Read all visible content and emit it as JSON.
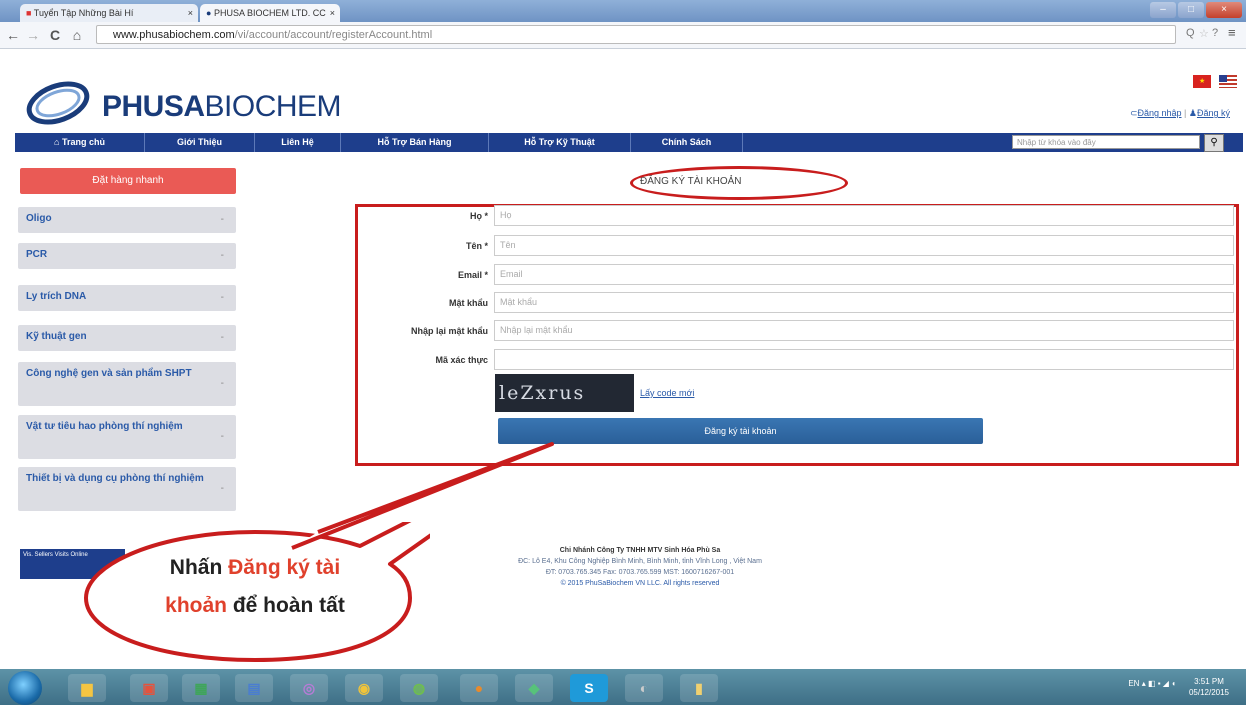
{
  "browser": {
    "tabs": [
      {
        "label": "Tuyển Tập Những Bài Hí",
        "close": "×"
      },
      {
        "label": "PHUSA BIOCHEM LTD. CC",
        "close": "×"
      }
    ],
    "window_controls": [
      "–",
      "□",
      "×"
    ],
    "nav": {
      "back": "←",
      "forward": "→",
      "reload": "C",
      "home": "⌂"
    },
    "url_host": "www.phusabiochem.com",
    "url_path": "/vi/account/account/registerAccount.html",
    "toolbar_icons": [
      "Q",
      "☆",
      "?",
      "≡"
    ]
  },
  "site": {
    "logo_bold": "PHUSA",
    "logo_light": "BIOCHEM",
    "login_link": "Đăng nhập",
    "register_link": "Đăng ký",
    "nav": [
      "Trang chủ",
      "Giới Thiệu",
      "Liên Hệ",
      "Hỗ Trợ Bán Hàng",
      "Hỗ Trợ Kỹ Thuật",
      "Chính Sách"
    ],
    "search_placeholder": "Nhập từ khóa vào đây",
    "search_icon": "search-icon"
  },
  "sidebar": {
    "quick_order": "Đặt hàng nhanh",
    "items": [
      {
        "label": "Oligo",
        "toggle": "-"
      },
      {
        "label": "PCR",
        "toggle": "-"
      },
      {
        "label": "Ly trích DNA",
        "toggle": "-"
      },
      {
        "label": "Kỹ thuật gen",
        "toggle": "-"
      },
      {
        "label": "Công nghệ gen và sản phẩm SHPT",
        "toggle": "-"
      },
      {
        "label": "Vật tư tiêu hao phòng thí nghiệm",
        "toggle": "-"
      },
      {
        "label": "Thiết bị và dụng cụ phòng thí nghiệm",
        "toggle": "-"
      }
    ]
  },
  "form": {
    "title": "ĐĂNG KÝ TÀI KHOẢN",
    "fields": [
      {
        "label": "Họ *",
        "placeholder": "Họ"
      },
      {
        "label": "Tên *",
        "placeholder": "Tên"
      },
      {
        "label": "Email *",
        "placeholder": "Email"
      },
      {
        "label": "Mật khẩu",
        "placeholder": "Mật khẩu"
      },
      {
        "label": "Nhập lại mật khẩu",
        "placeholder": "Nhập lại mật khẩu"
      },
      {
        "label": "Mã xác thực",
        "placeholder": ""
      }
    ],
    "captcha_text": "leZxrus",
    "new_code_link": "Lấy code mới",
    "submit": "Đăng ký tài khoản"
  },
  "footer": {
    "company": "Chi Nhánh Công Ty TNHH MTV Sinh Hóa Phù Sa",
    "address": "ĐC: Lô E4, Khu Công Nghiệp Bình Minh, Bình Minh, tỉnh Vĩnh Long , Việt Nam",
    "contact": "ĐT: 0703.765.345      Fax: 0703.765.599      MST: 1600716267-001",
    "copyright": "© 2015 PhuSaBiochem VN LLC. All rights reserved",
    "badge": "Vis. Sellers Visits Online"
  },
  "callout": {
    "text_1": "Nhấn ",
    "highlight_1": "Đăng ký tài",
    "highlight_2": "khoản",
    "text_2": " để hoàn tất"
  },
  "taskbar": {
    "icons": [
      "folder-icon",
      "presentation-icon",
      "excel-icon",
      "word-icon",
      "messenger-icon",
      "chrome-icon",
      "utorrent-icon",
      "firefox-icon",
      "network-icon",
      "skype-icon",
      "media-icon",
      "files-icon"
    ],
    "skype_letter": "S",
    "lang": "EN",
    "time": "3:51 PM",
    "date": "05/12/2015"
  },
  "colors": {
    "nav_blue": "#1e3e8c",
    "annotation_red": "#c81d1d",
    "quick_order_red": "#ea5a55",
    "submit_blue": "#2f6aa6",
    "callout_highlight": "#e0412c"
  }
}
